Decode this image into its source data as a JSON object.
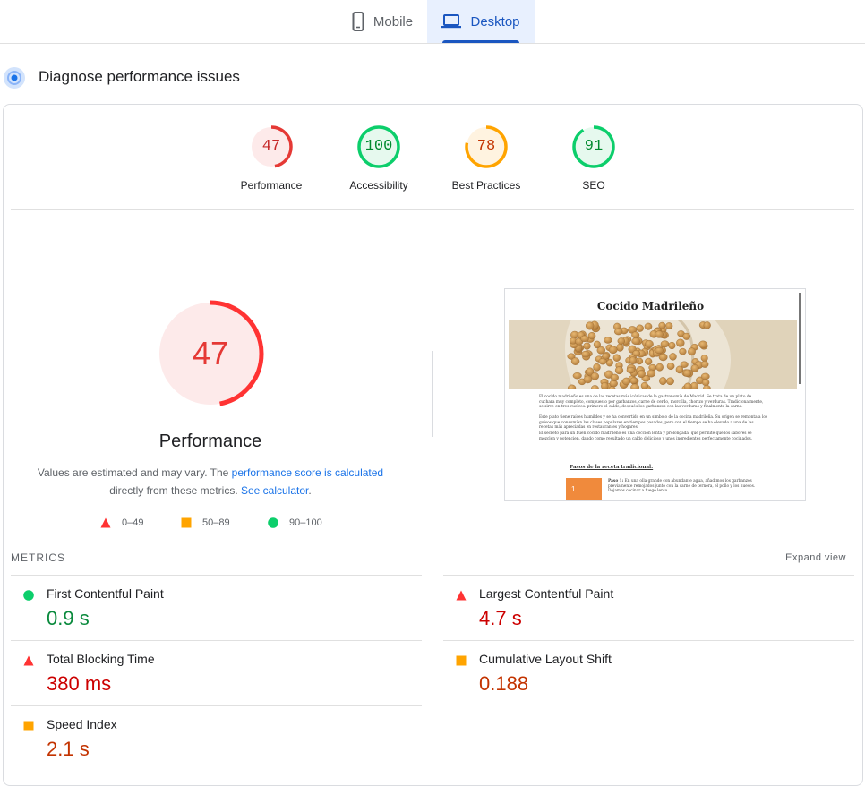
{
  "tabs": [
    {
      "label": "Mobile",
      "icon": "phone-icon"
    },
    {
      "label": "Desktop",
      "icon": "laptop-icon",
      "selected": true
    }
  ],
  "header": {
    "title": "Diagnose performance issues"
  },
  "gauges": [
    {
      "label": "Performance",
      "score": "47",
      "color": "#e53935",
      "fraction": 0.47
    },
    {
      "label": "Accessibility",
      "score": "100",
      "color": "#0cce6b",
      "fraction": 1.0
    },
    {
      "label": "Best Practices",
      "score": "78",
      "color": "#ffa400",
      "fraction": 0.78
    },
    {
      "label": "SEO",
      "score": "91",
      "color": "#0cce6b",
      "fraction": 0.91
    }
  ],
  "performance": {
    "score": "47",
    "fraction": 0.47,
    "label": "Performance",
    "note_part1": "Values are estimated and may vary. The ",
    "note_link1": "performance score is calculated",
    "note_part2": " directly from these metrics. ",
    "note_link2": "See calculator",
    "note_part3": "."
  },
  "legend": [
    {
      "range": "0–49",
      "shape": "triangle",
      "color": "#ff3333"
    },
    {
      "range": "50–89",
      "shape": "square",
      "color": "#ffa400"
    },
    {
      "range": "90–100",
      "shape": "circle",
      "color": "#0cce6b"
    }
  ],
  "screenshot": {
    "title": "Cocido Madrileño",
    "para1": "El cocido madrileño es una de las recetas más icónicas de la gastronomía de Madrid. Se trata de un plato de cuchara muy completo, compuesto por garbanzos, carne de cerdo, morcilla, chorizo y verduras. Tradicionalmente, se sirve en tres vuelcos: primero el caldo, después los garbanzos con las verduras y finalmente la carne.",
    "para2": "Este plato tiene raíces humildes y se ha convertido en un símbolo de la cocina madrileña. Su origen se remonta a los guisos que consumían las clases populares en tiempos pasados, pero con el tiempo se ha elevado a una de las recetas más apreciadas en restaurantes y hogares.",
    "para3": "El secreto para un buen cocido madrileño es una cocción lenta y prolongada, que permite que los sabores se mezclen y potencien, dando como resultado un caldo delicioso y unos ingredientes perfectamente cocinados.",
    "pasos": "Pasos de la receta tradicional:",
    "step_num": "1",
    "paso_label": "Paso 1:",
    "paso_text": " En una olla grande con abundante agua, añadimos los garbanzos previamente remojados junto con la carne de ternera, el pollo y los huesos. Dejamos cocinar a fuego lento"
  },
  "metrics": {
    "heading": "METRICS",
    "expand": "Expand view",
    "items": [
      {
        "name": "First Contentful Paint",
        "value": "0.9 s",
        "rating": "pass",
        "icon": "circle",
        "color": "#0cce6b",
        "text_color": "#0a8a3d"
      },
      {
        "name": "Largest Contentful Paint",
        "value": "4.7 s",
        "rating": "fail",
        "icon": "triangle",
        "color": "#ff3333",
        "text_color": "#cc0000"
      },
      {
        "name": "Total Blocking Time",
        "value": "380 ms",
        "rating": "fail",
        "icon": "triangle",
        "color": "#ff3333",
        "text_color": "#cc0000"
      },
      {
        "name": "Cumulative Layout Shift",
        "value": "0.188",
        "rating": "average",
        "icon": "square",
        "color": "#ffa400",
        "text_color": "#c33300"
      },
      {
        "name": "Speed Index",
        "value": "2.1 s",
        "rating": "average",
        "icon": "square",
        "color": "#ffa400",
        "text_color": "#c33300"
      }
    ]
  }
}
